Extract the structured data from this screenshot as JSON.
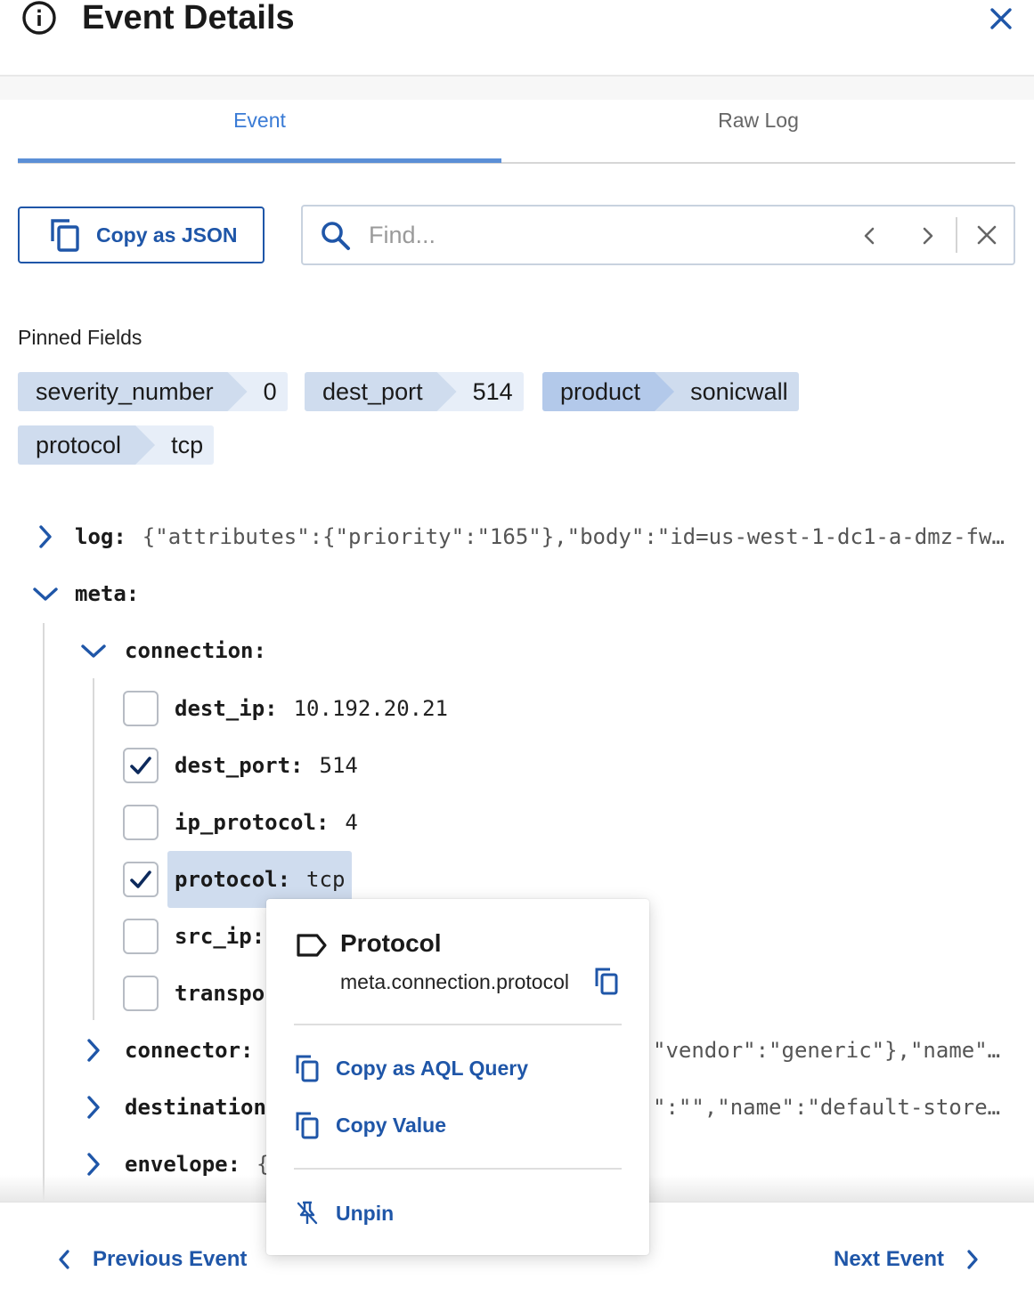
{
  "header": {
    "title": "Event Details"
  },
  "tabs": [
    {
      "label": "Event"
    },
    {
      "label": "Raw Log"
    }
  ],
  "toolbar": {
    "copy_json_label": "Copy as JSON",
    "search_placeholder": "Find...",
    "search_value": ""
  },
  "pinned": {
    "title": "Pinned Fields",
    "fields": [
      {
        "key": "severity_number",
        "value": "0"
      },
      {
        "key": "dest_port",
        "value": "514"
      },
      {
        "key": "product",
        "value": "sonicwall"
      },
      {
        "key": "protocol",
        "value": "tcp"
      }
    ]
  },
  "tree": {
    "log": {
      "key": "log:",
      "value": "{\"attributes\":{\"priority\":\"165\"},\"body\":\"id=us-west-1-dc1-a-dmz-fw…"
    },
    "meta": {
      "key": "meta:"
    },
    "connection": {
      "key": "connection:",
      "fields": [
        {
          "key": "dest_ip:",
          "value": "10.192.20.21",
          "checked": false
        },
        {
          "key": "dest_port:",
          "value": "514",
          "checked": true
        },
        {
          "key": "ip_protocol:",
          "value": "4",
          "checked": false
        },
        {
          "key": "protocol:",
          "value": "tcp",
          "checked": true
        },
        {
          "key": "src_ip:",
          "value": "",
          "checked": false
        },
        {
          "key": "transpo",
          "value": "",
          "checked": false
        }
      ]
    },
    "connector": {
      "key": "connector:",
      "value": "\"vendor\":\"generic\"},\"name\"…"
    },
    "destination": {
      "key": "destination",
      "value": "\":\"\",\"name\":\"default-store…"
    },
    "envelope": {
      "key": "envelope:",
      "value": "{"
    }
  },
  "popover": {
    "title": "Protocol",
    "path": "meta.connection.protocol",
    "actions": [
      {
        "label": "Copy as AQL Query"
      },
      {
        "label": "Copy Value"
      }
    ],
    "unpin_label": "Unpin"
  },
  "footer": {
    "prev_label": "Previous Event",
    "next_label": "Next Event"
  },
  "colors": {
    "accent": "#1f56a8",
    "tab_active": "#3a7bd5",
    "chip": "#cfdcee",
    "chip_active": "#b3c9ea"
  }
}
